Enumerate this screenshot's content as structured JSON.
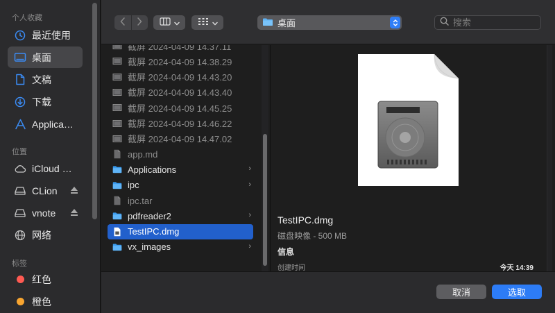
{
  "sidebar": {
    "sections": {
      "favorites": "个人收藏",
      "locations": "位置",
      "tags": "标签"
    },
    "favorites": [
      {
        "label": "最近使用",
        "icon": "clock-icon"
      },
      {
        "label": "桌面",
        "icon": "desktop-icon",
        "selected": true
      },
      {
        "label": "文稿",
        "icon": "document-icon"
      },
      {
        "label": "下载",
        "icon": "download-icon"
      },
      {
        "label": "Applica…",
        "icon": "applications-icon"
      }
    ],
    "locations": [
      {
        "label": "iCloud …",
        "icon": "cloud-icon"
      },
      {
        "label": "CLion",
        "icon": "drive-icon"
      },
      {
        "label": "vnote",
        "icon": "drive-icon"
      },
      {
        "label": "网络",
        "icon": "globe-icon"
      }
    ],
    "tags": [
      {
        "label": "红色",
        "color": "#ff5a52"
      },
      {
        "label": "橙色",
        "color": "#f8a530"
      }
    ]
  },
  "toolbar": {
    "location": "桌面",
    "search_placeholder": "搜索"
  },
  "files": [
    {
      "name": "截屏 2024-04-09 14.37.11",
      "dim": true,
      "icon": "screenshot-icon"
    },
    {
      "name": "截屏 2024-04-09 14.38.29",
      "dim": true,
      "icon": "screenshot-icon"
    },
    {
      "name": "截屏 2024-04-09 14.43.20",
      "dim": true,
      "icon": "screenshot-icon"
    },
    {
      "name": "截屏 2024-04-09 14.43.40",
      "dim": true,
      "icon": "screenshot-icon"
    },
    {
      "name": "截屏 2024-04-09 14.45.25",
      "dim": true,
      "icon": "screenshot-icon"
    },
    {
      "name": "截屏 2024-04-09 14.46.22",
      "dim": true,
      "icon": "screenshot-icon"
    },
    {
      "name": "截屏 2024-04-09 14.47.02",
      "dim": true,
      "icon": "screenshot-icon"
    },
    {
      "name": "app.md",
      "dim": true,
      "icon": "file-icon"
    },
    {
      "name": "Applications",
      "dim": false,
      "icon": "folder-icon",
      "chevron": "›"
    },
    {
      "name": "ipc",
      "dim": false,
      "icon": "folder-icon",
      "chevron": "›"
    },
    {
      "name": "ipc.tar",
      "dim": true,
      "icon": "file-icon"
    },
    {
      "name": "pdfreader2",
      "dim": false,
      "icon": "folder-icon",
      "chevron": "›"
    },
    {
      "name": "TestIPC.dmg",
      "dim": false,
      "icon": "dmg-icon",
      "selected": true
    },
    {
      "name": "vx_images",
      "dim": false,
      "icon": "folder-icon",
      "chevron": "›"
    }
  ],
  "preview": {
    "name": "TestIPC.dmg",
    "kind": "磁盘映像 - 500 MB",
    "info_heading": "信息",
    "created_label": "创建时间",
    "created_value": "今天 14:39"
  },
  "buttons": {
    "cancel": "取消",
    "open": "选取"
  }
}
